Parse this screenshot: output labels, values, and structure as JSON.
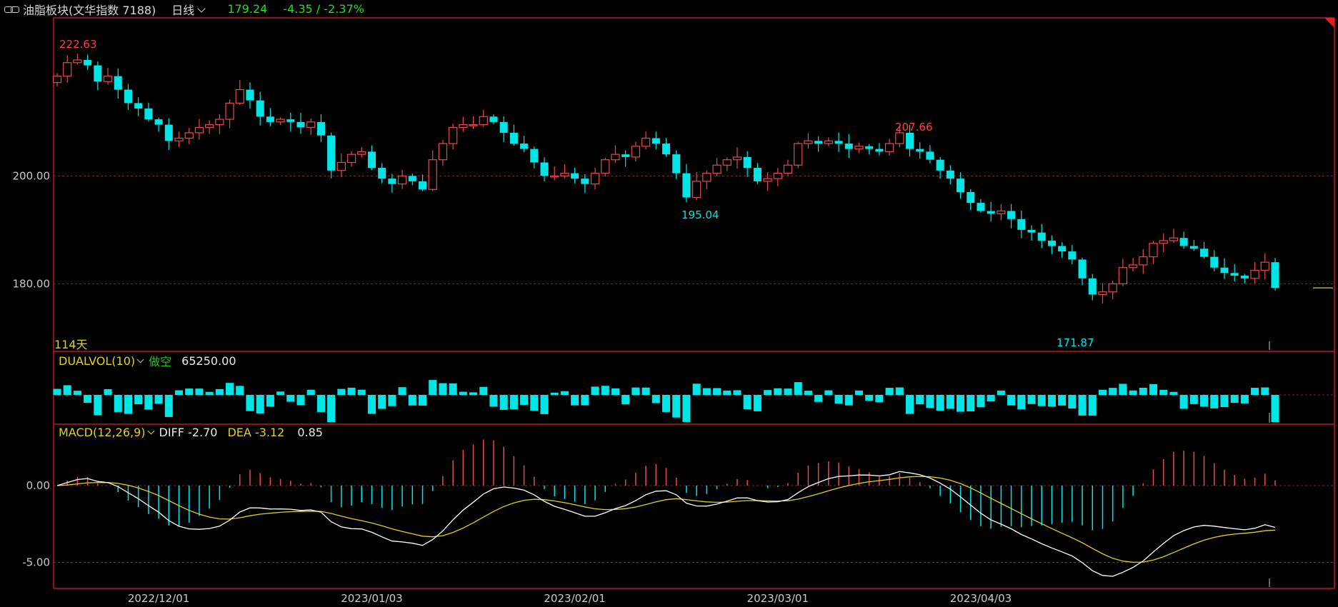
{
  "header": {
    "title": "油脂板块(文华指数 7188)",
    "period": "日线",
    "last_price": "179.24",
    "change": "-4.35 / -2.37%"
  },
  "main_panel": {
    "y_ticks": [
      "200.00",
      "180.00"
    ],
    "y_tick_values": [
      200,
      180
    ],
    "annotations": {
      "high": "222.63",
      "mid_high": "207.66",
      "mid_low": "195.04",
      "low": "171.87"
    },
    "days_label": "114天"
  },
  "dualvol": {
    "name": "DUALVOL(10)",
    "mode": "做空",
    "value": "65250.00"
  },
  "macd": {
    "name": "MACD(12,26,9)",
    "diff_label": "DIFF -2.70",
    "dea_label": "DEA -3.12",
    "macd_value": "0.85",
    "y_ticks": [
      "0.00",
      "-5.00"
    ],
    "y_tick_values": [
      0,
      -5
    ]
  },
  "x_axis": {
    "labels": [
      "2022/12/01",
      "2023/01/03",
      "2023/02/01",
      "2023/03/01",
      "2023/04/03"
    ],
    "label_index": [
      10,
      31,
      51,
      71,
      91
    ]
  },
  "colors": {
    "up": "#e84a4a",
    "down": "#00e5e5",
    "frame": "#c01818",
    "dea": "#e0d020",
    "diff": "#ffffff",
    "grid": "#a01818"
  },
  "chart_data": {
    "type": "candlestick",
    "close": [
      218.5,
      221,
      221.5,
      220.5,
      217.5,
      218.5,
      216,
      213.5,
      212.5,
      210.5,
      209.5,
      206.5,
      207,
      208,
      209,
      209.5,
      210.5,
      213.5,
      216,
      214,
      211,
      210,
      210.5,
      210,
      209,
      210,
      207.5,
      201,
      202.5,
      204,
      204.5,
      201.5,
      199.5,
      198.5,
      200,
      199,
      197.5,
      203,
      206,
      209,
      209.5,
      209.5,
      211,
      210,
      208,
      206,
      205,
      202.5,
      200,
      200,
      200.5,
      199.5,
      198.5,
      200.5,
      203,
      204,
      203.5,
      205.5,
      207,
      206,
      204,
      200.5,
      196,
      199,
      200.5,
      202,
      203,
      203.5,
      201.5,
      199,
      199.5,
      200.5,
      202,
      206,
      206.5,
      206,
      206.5,
      206,
      205,
      205.5,
      205,
      204.5,
      206,
      208,
      205,
      204.5,
      203,
      201,
      199.5,
      197,
      195,
      193.5,
      193,
      193.5,
      192,
      190,
      189.5,
      188,
      187,
      186,
      184.5,
      181,
      178,
      178.5,
      180,
      183,
      183.5,
      185,
      187.5,
      188,
      188.5,
      187,
      186.5,
      185,
      183,
      182,
      181.5,
      181,
      182.5,
      184,
      179.24
    ]
  }
}
